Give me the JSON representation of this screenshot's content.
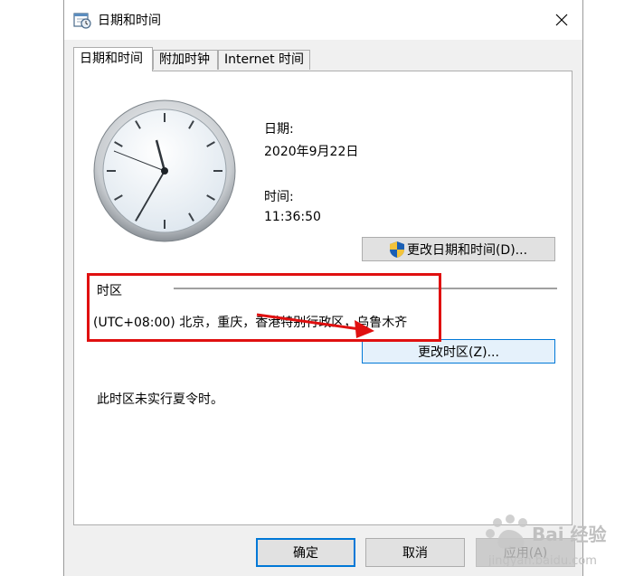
{
  "window": {
    "title": "日期和时间",
    "close_glyph": "✕",
    "icon": "calendar-clock-icon"
  },
  "tabs": [
    {
      "label": "日期和时间",
      "active": true
    },
    {
      "label": "附加时钟",
      "active": false
    },
    {
      "label": "Internet 时间",
      "active": false
    }
  ],
  "date": {
    "label": "日期:",
    "value": "2020年9月22日"
  },
  "time": {
    "label": "时间:",
    "value": "11:36:50"
  },
  "buttons": {
    "change_datetime": "更改日期和时间(D)...",
    "change_timezone": "更改时区(Z)..."
  },
  "timezone": {
    "heading": "时区",
    "value": "(UTC+08:00) 北京，重庆，香港特别行政区，乌鲁木齐",
    "dst_note": "此时区未实行夏令时。"
  },
  "footer": {
    "ok": "确定",
    "cancel": "取消",
    "apply": "应用(A)"
  },
  "colors": {
    "accent": "#0078d7",
    "highlight_box": "#e01010"
  }
}
